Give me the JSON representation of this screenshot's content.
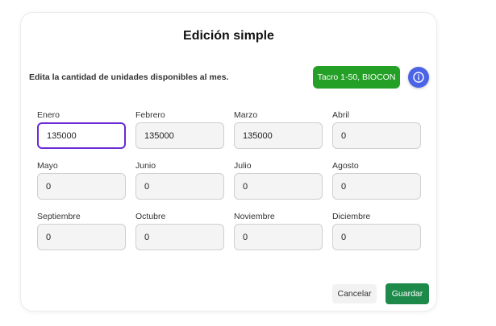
{
  "dialog": {
    "title": "Edición simple",
    "subtitle": "Edita la cantidad de unidades disponibles al mes.",
    "product_badge": "Tacro 1-50, BIOCON",
    "info_icon": "info-icon",
    "colors": {
      "badge": "#23a025",
      "info": "#4b63e6",
      "save": "#1d8a4a",
      "focus": "#6a2ad6"
    }
  },
  "months": [
    {
      "label": "Enero",
      "value": "135000"
    },
    {
      "label": "Febrero",
      "value": "135000"
    },
    {
      "label": "Marzo",
      "value": "135000"
    },
    {
      "label": "Abril",
      "value": "0"
    },
    {
      "label": "Mayo",
      "value": "0"
    },
    {
      "label": "Junio",
      "value": "0"
    },
    {
      "label": "Julio",
      "value": "0"
    },
    {
      "label": "Agosto",
      "value": "0"
    },
    {
      "label": "Septiembre",
      "value": "0"
    },
    {
      "label": "Octubre",
      "value": "0"
    },
    {
      "label": "Noviembre",
      "value": "0"
    },
    {
      "label": "Diciembre",
      "value": "0"
    }
  ],
  "actions": {
    "cancel": "Cancelar",
    "save": "Guardar"
  }
}
